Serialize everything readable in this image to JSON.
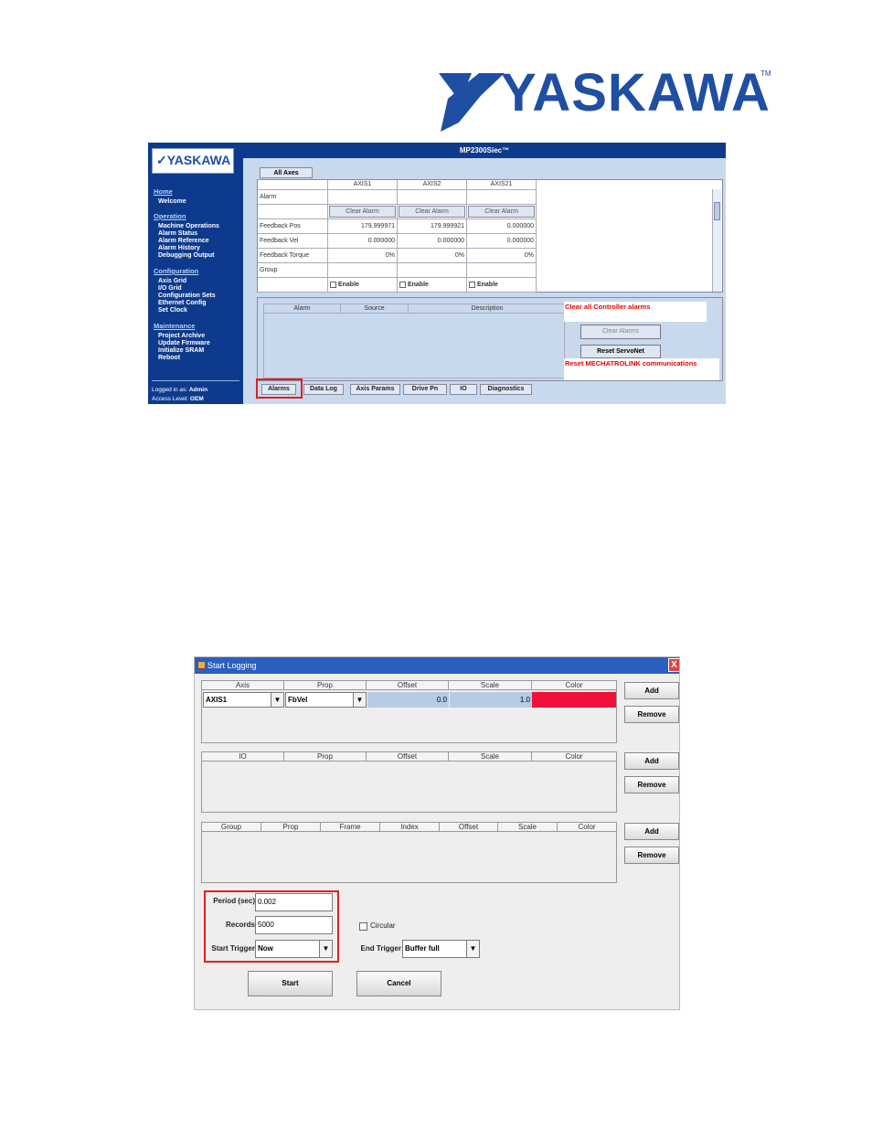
{
  "brand": {
    "name": "YASKAWA",
    "tm": "TM"
  },
  "shot1": {
    "title": "MP2300Siec™",
    "sidebar": {
      "logo": "YASKAWA",
      "home": "Home",
      "home_items": [
        "Welcome"
      ],
      "operation": "Operation",
      "operation_items": [
        "Machine Operations",
        "Alarm Status",
        "Alarm Reference",
        "Alarm History",
        "Debugging Output"
      ],
      "configuration": "Configuration",
      "configuration_items": [
        "Axis Grid",
        "I/O Grid",
        "Configuration Sets",
        "Ethernet Config",
        "Set Clock"
      ],
      "maintenance": "Maintenance",
      "maintenance_items": [
        "Project Archive",
        "Update Firmware",
        "Initialize SRAM",
        "Reboot"
      ],
      "logged_in_label": "Logged in as:",
      "logged_in_user": "Admin",
      "access_label": "Access Level:",
      "access_value": "OEM"
    },
    "all_axes_tab": "All Axes",
    "grid": {
      "columns": [
        "AXIS1",
        "AXIS2",
        "AXIS21"
      ],
      "row_labels": [
        "Alarm",
        "",
        "Feedback Pos",
        "Feedback Vel",
        "Feedback Torque",
        "Group",
        ""
      ],
      "clear_alarm": "Clear Alarm",
      "feedback_pos": [
        "179.999971",
        "179.999921",
        "0.000000"
      ],
      "feedback_vel": [
        "0.000000",
        "0.000000",
        "0.000000"
      ],
      "feedback_torque": [
        "0%",
        "0%",
        "0%"
      ],
      "enable": "Enable"
    },
    "alarm_table_headers": [
      "Alarm",
      "Source",
      "Description"
    ],
    "note_clear": "Clear all Controller alarms",
    "clear_alarms": "Clear Alarms",
    "reset_servonet": "Reset ServoNet",
    "note_reset": "Reset MECHATROLINK communications",
    "tabs": [
      "Alarms",
      "Data Log",
      "Axis Params",
      "Drive Pn",
      "IO",
      "Diagnostics"
    ]
  },
  "shot2": {
    "title": "Start Logging",
    "close": "X",
    "axis_headers": [
      "Axis",
      "Prop",
      "Offset",
      "Scale",
      "Color"
    ],
    "axis_row": {
      "axis": "AXIS1",
      "prop": "FbVel",
      "offset": "0.0",
      "scale": "1.0",
      "color": "#f0103a"
    },
    "io_headers": [
      "IO",
      "Prop",
      "Offset",
      "Scale",
      "Color"
    ],
    "group_headers": [
      "Group",
      "Prop",
      "Frame",
      "Index",
      "Offset",
      "Scale",
      "Color"
    ],
    "add": "Add",
    "remove": "Remove",
    "period_label": "Period (sec)",
    "period_value": "0.002",
    "records_label": "Records",
    "records_value": "5000",
    "start_trigger_label": "Start Trigger",
    "start_trigger_value": "Now",
    "circular_label": "Circular",
    "end_trigger_label": "End Trigger",
    "end_trigger_value": "Buffer full",
    "start": "Start",
    "cancel": "Cancel"
  }
}
